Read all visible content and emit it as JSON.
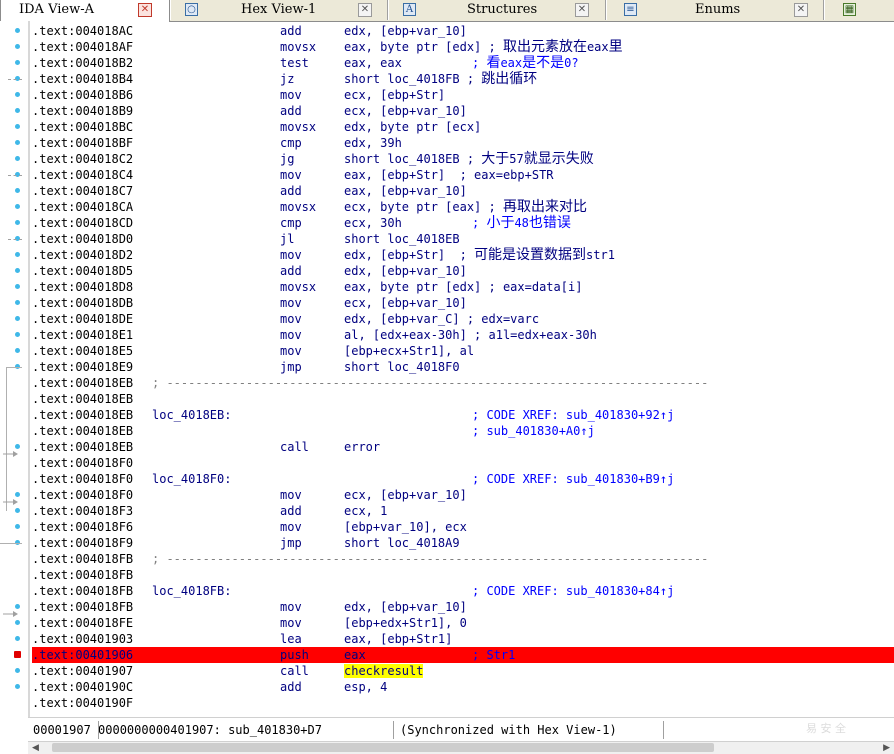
{
  "tabs": [
    {
      "label": "IDA View-A",
      "icon": "close-icon"
    },
    {
      "label": "Hex View-1",
      "icon": "hex-view-icon"
    },
    {
      "label": "Structures",
      "icon": "structures-icon"
    },
    {
      "label": "Enums",
      "icon": "enums-icon"
    },
    {
      "label": "",
      "icon": "imports-icon"
    }
  ],
  "rows": [
    {
      "addr": ".text:004018AC",
      "lbl": "",
      "mn": "add",
      "op": "edx, [ebp+var_10]",
      "cm": ""
    },
    {
      "addr": ".text:004018AF",
      "lbl": "",
      "mn": "movsx",
      "op": "eax, byte ptr [edx] ; 取出元素放在eax里",
      "cm": ""
    },
    {
      "addr": ".text:004018B2",
      "lbl": "",
      "mn": "test",
      "op": "eax, eax",
      "cm": "; 看eax是不是0?"
    },
    {
      "addr": ".text:004018B4",
      "lbl": "",
      "mn": "jz",
      "op": "short loc_4018FB ; 跳出循环",
      "cm": ""
    },
    {
      "addr": ".text:004018B6",
      "lbl": "",
      "mn": "mov",
      "op": "ecx, [ebp+Str]",
      "cm": ""
    },
    {
      "addr": ".text:004018B9",
      "lbl": "",
      "mn": "add",
      "op": "ecx, [ebp+var_10]",
      "cm": ""
    },
    {
      "addr": ".text:004018BC",
      "lbl": "",
      "mn": "movsx",
      "op": "edx, byte ptr [ecx]",
      "cm": ""
    },
    {
      "addr": ".text:004018BF",
      "lbl": "",
      "mn": "cmp",
      "op": "edx, 39h",
      "cm": ""
    },
    {
      "addr": ".text:004018C2",
      "lbl": "",
      "mn": "jg",
      "op": "short loc_4018EB ; 大于57就显示失败",
      "cm": ""
    },
    {
      "addr": ".text:004018C4",
      "lbl": "",
      "mn": "mov",
      "op": "eax, [ebp+Str]  ; eax=ebp+STR",
      "cm": ""
    },
    {
      "addr": ".text:004018C7",
      "lbl": "",
      "mn": "add",
      "op": "eax, [ebp+var_10]",
      "cm": ""
    },
    {
      "addr": ".text:004018CA",
      "lbl": "",
      "mn": "movsx",
      "op": "ecx, byte ptr [eax] ; 再取出来对比",
      "cm": ""
    },
    {
      "addr": ".text:004018CD",
      "lbl": "",
      "mn": "cmp",
      "op": "ecx, 30h",
      "cm": "; 小于48也错误"
    },
    {
      "addr": ".text:004018D0",
      "lbl": "",
      "mn": "jl",
      "op": "short loc_4018EB",
      "cm": ""
    },
    {
      "addr": ".text:004018D2",
      "lbl": "",
      "mn": "mov",
      "op": "edx, [ebp+Str]  ; 可能是设置数据到str1",
      "cm": ""
    },
    {
      "addr": ".text:004018D5",
      "lbl": "",
      "mn": "add",
      "op": "edx, [ebp+var_10]",
      "cm": ""
    },
    {
      "addr": ".text:004018D8",
      "lbl": "",
      "mn": "movsx",
      "op": "eax, byte ptr [edx] ; eax=data[i]",
      "cm": ""
    },
    {
      "addr": ".text:004018DB",
      "lbl": "",
      "mn": "mov",
      "op": "ecx, [ebp+var_10]",
      "cm": ""
    },
    {
      "addr": ".text:004018DE",
      "lbl": "",
      "mn": "mov",
      "op": "edx, [ebp+var_C] ; edx=varc",
      "cm": ""
    },
    {
      "addr": ".text:004018E1",
      "lbl": "",
      "mn": "mov",
      "op": "al, [edx+eax-30h] ; a1l=edx+eax-30h",
      "cm": ""
    },
    {
      "addr": ".text:004018E5",
      "lbl": "",
      "mn": "mov",
      "op": "[ebp+ecx+Str1], al",
      "cm": ""
    },
    {
      "addr": ".text:004018E9",
      "lbl": "",
      "mn": "jmp",
      "op": "short loc_4018F0",
      "cm": ""
    },
    {
      "addr": ".text:004018EB",
      "sep": "; ---------------------------------------------------------------------------"
    },
    {
      "addr": ".text:004018EB",
      "lbl": "",
      "mn": "",
      "op": "",
      "cm": ""
    },
    {
      "addr": ".text:004018EB",
      "lbl": "loc_4018EB:",
      "mn": "",
      "op": "",
      "cm": "; CODE XREF: sub_401830+92↑j"
    },
    {
      "addr": ".text:004018EB",
      "lbl": "",
      "mn": "",
      "op": "",
      "cm": "; sub_401830+A0↑j"
    },
    {
      "addr": ".text:004018EB",
      "lbl": "",
      "mn": "call",
      "op": "error",
      "cm": ""
    },
    {
      "addr": ".text:004018F0",
      "lbl": "",
      "mn": "",
      "op": "",
      "cm": ""
    },
    {
      "addr": ".text:004018F0",
      "lbl": "loc_4018F0:",
      "mn": "",
      "op": "",
      "cm": "; CODE XREF: sub_401830+B9↑j"
    },
    {
      "addr": ".text:004018F0",
      "lbl": "",
      "mn": "mov",
      "op": "ecx, [ebp+var_10]",
      "cm": ""
    },
    {
      "addr": ".text:004018F3",
      "lbl": "",
      "mn": "add",
      "op": "ecx, 1",
      "cm": ""
    },
    {
      "addr": ".text:004018F6",
      "lbl": "",
      "mn": "mov",
      "op": "[ebp+var_10], ecx",
      "cm": ""
    },
    {
      "addr": ".text:004018F9",
      "lbl": "",
      "mn": "jmp",
      "op": "short loc_4018A9",
      "cm": ""
    },
    {
      "addr": ".text:004018FB",
      "sep": "; ---------------------------------------------------------------------------"
    },
    {
      "addr": ".text:004018FB",
      "lbl": "",
      "mn": "",
      "op": "",
      "cm": ""
    },
    {
      "addr": ".text:004018FB",
      "lbl": "loc_4018FB:",
      "mn": "",
      "op": "",
      "cm": "; CODE XREF: sub_401830+84↑j"
    },
    {
      "addr": ".text:004018FB",
      "lbl": "",
      "mn": "mov",
      "op": "edx, [ebp+var_10]",
      "cm": ""
    },
    {
      "addr": ".text:004018FE",
      "lbl": "",
      "mn": "mov",
      "op": "[ebp+edx+Str1], 0",
      "cm": ""
    },
    {
      "addr": ".text:00401903",
      "lbl": "",
      "mn": "lea",
      "op": "eax, [ebp+Str1]",
      "cm": ""
    },
    {
      "addr": ".text:00401906",
      "lbl": "",
      "mn": "push",
      "op": "eax",
      "cm": "; Str1",
      "highlight": true
    },
    {
      "addr": ".text:00401907",
      "lbl": "",
      "mn": "call",
      "op": "checkresult",
      "cm": "",
      "selected": true
    },
    {
      "addr": ".text:0040190C",
      "lbl": "",
      "mn": "add",
      "op": "esp, 4",
      "cm": ""
    },
    {
      "addr": ".text:0040190F",
      "lbl": "",
      "mn": "",
      "op": "",
      "cm": ""
    }
  ],
  "status": {
    "position": "00001907 0000000000401907: sub_401830+D7",
    "sync": "(Synchronized with Hex View-1)"
  },
  "watermark": "易 安 全",
  "colors": {
    "accent": "#ff0000",
    "address": "#000000",
    "code": "#000080",
    "comment": "#0000ff",
    "separator": "#808080",
    "selection": "#ffff00",
    "gutter_dot": "#3fb8e8"
  }
}
